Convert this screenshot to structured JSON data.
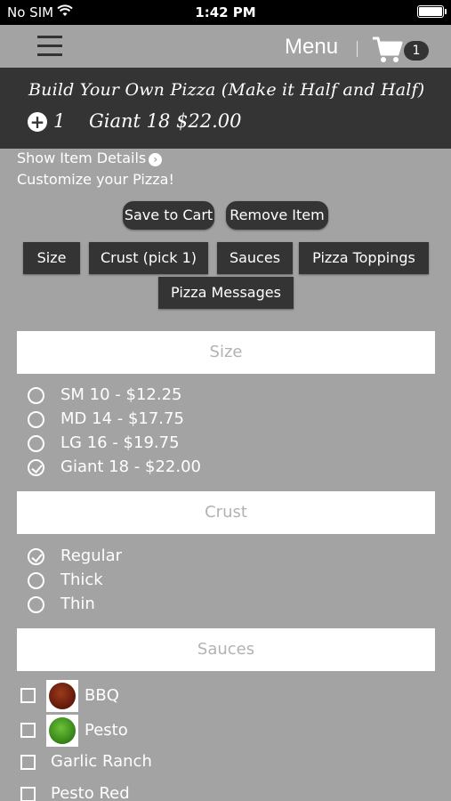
{
  "status_bar": {
    "carrier": "No SIM",
    "time": "1:42 PM"
  },
  "nav": {
    "menu_label": "Menu",
    "cart_count": "1"
  },
  "item": {
    "title": "Build Your Own Pizza (Make it Half and Half)",
    "quantity": "1",
    "size_price": "Giant 18 $22.00"
  },
  "details": {
    "show_item_details": "Show Item Details",
    "customize_text": "Customize your Pizza!"
  },
  "actions": {
    "save_to_cart": "Save to Cart",
    "remove_item": "Remove Item"
  },
  "tabs": [
    {
      "label": "Size"
    },
    {
      "label": "Crust (pick 1)"
    },
    {
      "label": "Sauces"
    },
    {
      "label": "Pizza Toppings"
    },
    {
      "label": "Pizza Messages"
    }
  ],
  "size_section": {
    "title": "Size",
    "options": [
      {
        "label": "SM 10 - $12.25",
        "checked": false
      },
      {
        "label": "MD 14 - $17.75",
        "checked": false
      },
      {
        "label": "LG 16 - $19.75",
        "checked": false
      },
      {
        "label": "Giant 18 - $22.00",
        "checked": true
      }
    ]
  },
  "crust_section": {
    "title": "Crust",
    "options": [
      {
        "label": "Regular",
        "checked": true
      },
      {
        "label": "Thick",
        "checked": false
      },
      {
        "label": "Thin",
        "checked": false
      }
    ]
  },
  "sauces_section": {
    "title": "Sauces",
    "options": [
      {
        "label": "BBQ",
        "checked": false,
        "image": "bbq-sauce-thumbnail",
        "color": "#7a2a12"
      },
      {
        "label": "Pesto",
        "checked": false,
        "image": "pesto-sauce-thumbnail",
        "color": "#3f8f1e"
      },
      {
        "label": "Garlic Ranch",
        "checked": false
      },
      {
        "label": "Pesto Red",
        "checked": false
      }
    ]
  },
  "colors": {
    "background": "#a3a3a3",
    "dark": "#343434",
    "section_header_text": "#b2b2b2"
  }
}
